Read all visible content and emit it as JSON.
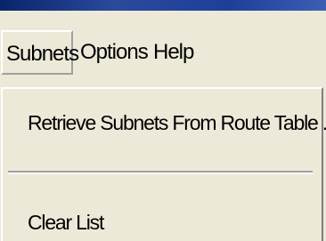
{
  "colors": {
    "title_bar": "#0a246a",
    "menu_background": "#ece9d8",
    "text": "#000000",
    "separator_shadow": "#a0a0a0",
    "separator_highlight": "#ffffff"
  },
  "menubar": {
    "items": [
      {
        "label": "Subnets"
      },
      {
        "label": "Options"
      },
      {
        "label": "Help"
      }
    ]
  },
  "dropdown": {
    "items": [
      {
        "label": "Retrieve Subnets From Route Table ..."
      },
      {
        "label": "Clear List"
      }
    ]
  }
}
